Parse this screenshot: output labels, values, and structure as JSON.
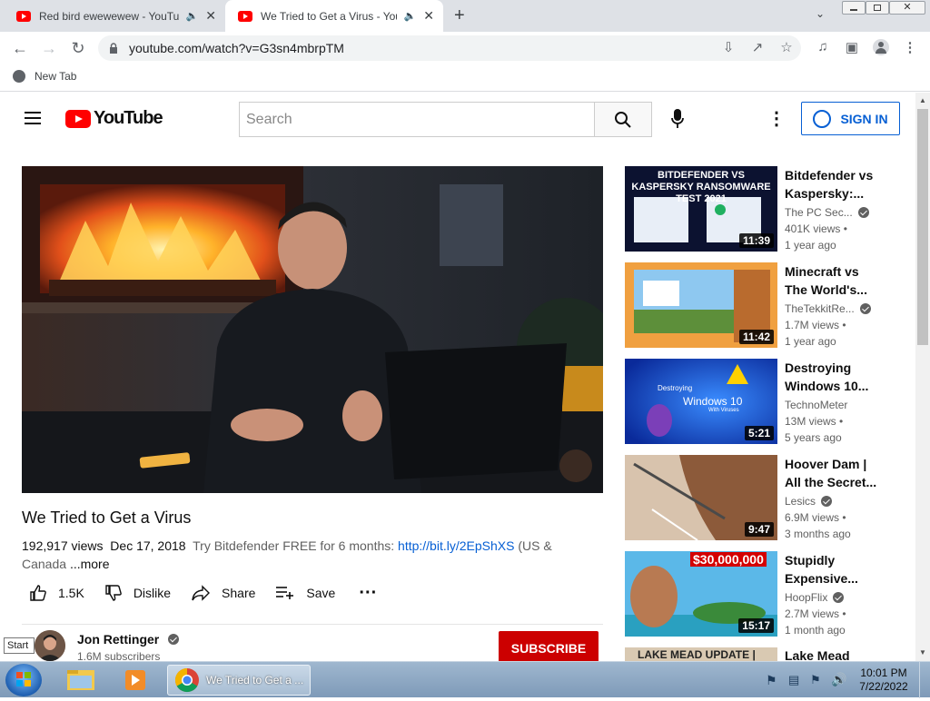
{
  "browser": {
    "tabs": [
      {
        "title": "Red bird ewewewew - YouTube",
        "active": false
      },
      {
        "title": "We Tried to Get a Virus - YouTube",
        "active": true
      }
    ],
    "url": "youtube.com/watch?v=G3sn4mbrpTM",
    "bookmarks": [
      {
        "label": "New Tab"
      }
    ]
  },
  "youtube": {
    "logo_text": "YouTube",
    "search_placeholder": "Search",
    "sign_in_label": "SIGN IN",
    "video": {
      "title": "We Tried to Get a Virus",
      "views": "192,917 views",
      "date": "Dec 17, 2018",
      "description": "Try Bitdefender FREE for 6 months:",
      "description_link": "http://bit.ly/2EpShXS",
      "description_tail": "(US &",
      "description_line2": "Canada",
      "more_label": "...more",
      "likes": "1.5K",
      "dislike_label": "Dislike",
      "share_label": "Share",
      "save_label": "Save",
      "channel": "Jon Rettinger",
      "subscribers": "1.6M subscribers",
      "subscribe_label": "SUBSCRIBE"
    },
    "recommendations": [
      {
        "title": "Bitdefender vs Kaspersky:...",
        "channel": "The PC Sec...",
        "verified": true,
        "views": "401K views •",
        "age": "1 year ago",
        "duration": "11:39",
        "thumb_text": "BITDEFENDER VS KASPERSKY RANSOMWARE TEST 2021"
      },
      {
        "title": "Minecraft vs The World's...",
        "channel": "TheTekkitRe...",
        "verified": true,
        "views": "1.7M views •",
        "age": "1 year ago",
        "duration": "11:42"
      },
      {
        "title": "Destroying Windows 10...",
        "channel": "TechnoMeter",
        "verified": false,
        "views": "13M views •",
        "age": "5 years ago",
        "duration": "5:21",
        "thumb_text": "Destroying",
        "thumb_text2": "Windows 10",
        "thumb_text3": "With Viruses"
      },
      {
        "title": "Hoover Dam | All the Secret...",
        "channel": "Lesics",
        "verified": true,
        "views": "6.9M views •",
        "age": "3 months ago",
        "duration": "9:47"
      },
      {
        "title": "Stupidly Expensive...",
        "channel": "HoopFlix",
        "verified": true,
        "views": "2.7M views •",
        "age": "1 month ago",
        "duration": "15:17",
        "thumb_text": "$30,000,000"
      },
      {
        "title": "Lake Mead",
        "thumb_text": "LAKE MEAD UPDATE |"
      }
    ]
  },
  "tooltip": "Start",
  "taskbar": {
    "chrome_label": "We Tried to Get a ...",
    "time": "10:01 PM",
    "date": "7/22/2022"
  }
}
